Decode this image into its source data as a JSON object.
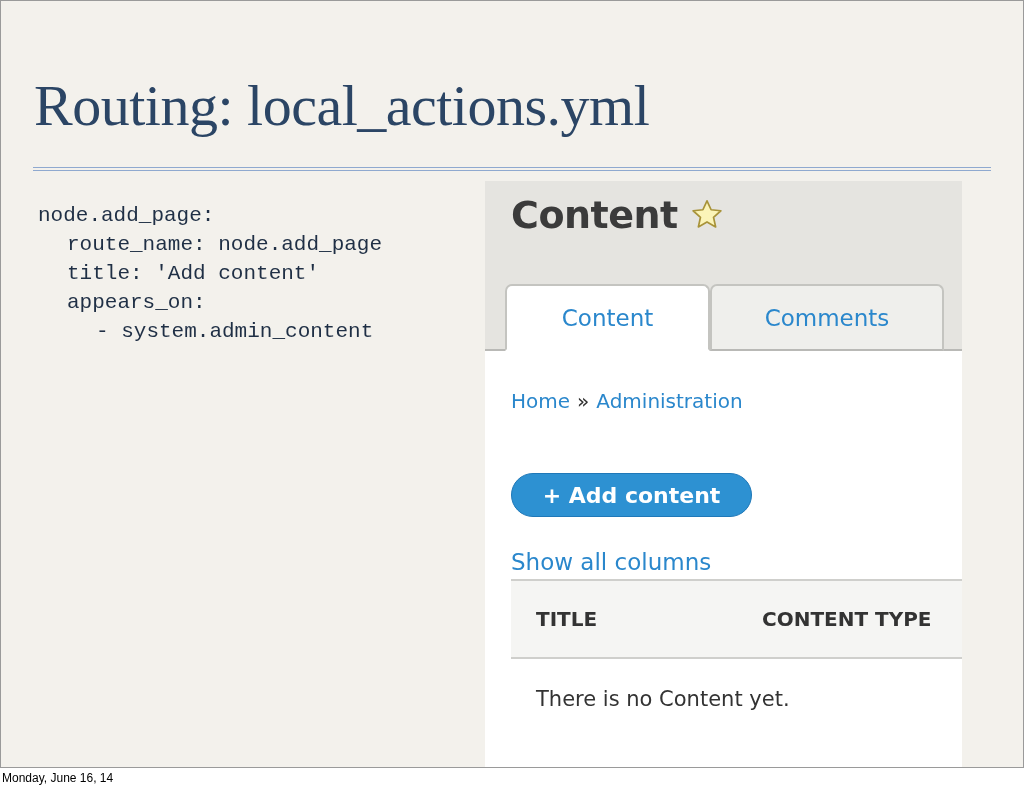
{
  "slide": {
    "title": "Routing: local_actions.yml",
    "code": [
      {
        "text": "node.add_page:",
        "children": [
          {
            "text": "route_name: node.add_page"
          },
          {
            "text": "title: 'Add content'"
          },
          {
            "text": "appears_on:",
            "children": [
              {
                "text": "- system.admin_content"
              }
            ]
          }
        ]
      }
    ]
  },
  "screenshot": {
    "page_title": "Content",
    "tabs": [
      {
        "label": "Content",
        "selected": true
      },
      {
        "label": "Comments",
        "selected": false
      }
    ],
    "breadcrumb": [
      {
        "label": "Home"
      },
      {
        "label": "Administration"
      }
    ],
    "breadcrumb_separator": "»",
    "action_button": "+ Add content",
    "show_columns_link": "Show all columns",
    "table": {
      "columns": [
        "TITLE",
        "CONTENT TYPE"
      ],
      "empty_message": "There is no Content yet."
    }
  },
  "footer": "Monday, June 16, 14"
}
